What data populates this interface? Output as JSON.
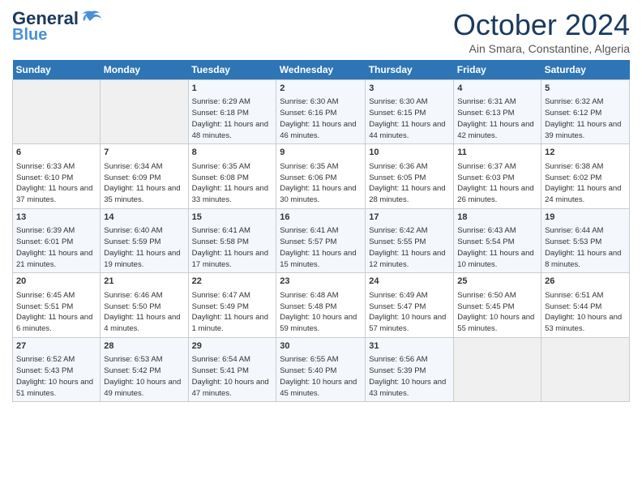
{
  "header": {
    "logo_line1": "General",
    "logo_line2": "Blue",
    "month": "October 2024",
    "location": "Ain Smara, Constantine, Algeria"
  },
  "days_of_week": [
    "Sunday",
    "Monday",
    "Tuesday",
    "Wednesday",
    "Thursday",
    "Friday",
    "Saturday"
  ],
  "weeks": [
    [
      {
        "day": "",
        "info": ""
      },
      {
        "day": "",
        "info": ""
      },
      {
        "day": "1",
        "info": "Sunrise: 6:29 AM\nSunset: 6:18 PM\nDaylight: 11 hours and 48 minutes."
      },
      {
        "day": "2",
        "info": "Sunrise: 6:30 AM\nSunset: 6:16 PM\nDaylight: 11 hours and 46 minutes."
      },
      {
        "day": "3",
        "info": "Sunrise: 6:30 AM\nSunset: 6:15 PM\nDaylight: 11 hours and 44 minutes."
      },
      {
        "day": "4",
        "info": "Sunrise: 6:31 AM\nSunset: 6:13 PM\nDaylight: 11 hours and 42 minutes."
      },
      {
        "day": "5",
        "info": "Sunrise: 6:32 AM\nSunset: 6:12 PM\nDaylight: 11 hours and 39 minutes."
      }
    ],
    [
      {
        "day": "6",
        "info": "Sunrise: 6:33 AM\nSunset: 6:10 PM\nDaylight: 11 hours and 37 minutes."
      },
      {
        "day": "7",
        "info": "Sunrise: 6:34 AM\nSunset: 6:09 PM\nDaylight: 11 hours and 35 minutes."
      },
      {
        "day": "8",
        "info": "Sunrise: 6:35 AM\nSunset: 6:08 PM\nDaylight: 11 hours and 33 minutes."
      },
      {
        "day": "9",
        "info": "Sunrise: 6:35 AM\nSunset: 6:06 PM\nDaylight: 11 hours and 30 minutes."
      },
      {
        "day": "10",
        "info": "Sunrise: 6:36 AM\nSunset: 6:05 PM\nDaylight: 11 hours and 28 minutes."
      },
      {
        "day": "11",
        "info": "Sunrise: 6:37 AM\nSunset: 6:03 PM\nDaylight: 11 hours and 26 minutes."
      },
      {
        "day": "12",
        "info": "Sunrise: 6:38 AM\nSunset: 6:02 PM\nDaylight: 11 hours and 24 minutes."
      }
    ],
    [
      {
        "day": "13",
        "info": "Sunrise: 6:39 AM\nSunset: 6:01 PM\nDaylight: 11 hours and 21 minutes."
      },
      {
        "day": "14",
        "info": "Sunrise: 6:40 AM\nSunset: 5:59 PM\nDaylight: 11 hours and 19 minutes."
      },
      {
        "day": "15",
        "info": "Sunrise: 6:41 AM\nSunset: 5:58 PM\nDaylight: 11 hours and 17 minutes."
      },
      {
        "day": "16",
        "info": "Sunrise: 6:41 AM\nSunset: 5:57 PM\nDaylight: 11 hours and 15 minutes."
      },
      {
        "day": "17",
        "info": "Sunrise: 6:42 AM\nSunset: 5:55 PM\nDaylight: 11 hours and 12 minutes."
      },
      {
        "day": "18",
        "info": "Sunrise: 6:43 AM\nSunset: 5:54 PM\nDaylight: 11 hours and 10 minutes."
      },
      {
        "day": "19",
        "info": "Sunrise: 6:44 AM\nSunset: 5:53 PM\nDaylight: 11 hours and 8 minutes."
      }
    ],
    [
      {
        "day": "20",
        "info": "Sunrise: 6:45 AM\nSunset: 5:51 PM\nDaylight: 11 hours and 6 minutes."
      },
      {
        "day": "21",
        "info": "Sunrise: 6:46 AM\nSunset: 5:50 PM\nDaylight: 11 hours and 4 minutes."
      },
      {
        "day": "22",
        "info": "Sunrise: 6:47 AM\nSunset: 5:49 PM\nDaylight: 11 hours and 1 minute."
      },
      {
        "day": "23",
        "info": "Sunrise: 6:48 AM\nSunset: 5:48 PM\nDaylight: 10 hours and 59 minutes."
      },
      {
        "day": "24",
        "info": "Sunrise: 6:49 AM\nSunset: 5:47 PM\nDaylight: 10 hours and 57 minutes."
      },
      {
        "day": "25",
        "info": "Sunrise: 6:50 AM\nSunset: 5:45 PM\nDaylight: 10 hours and 55 minutes."
      },
      {
        "day": "26",
        "info": "Sunrise: 6:51 AM\nSunset: 5:44 PM\nDaylight: 10 hours and 53 minutes."
      }
    ],
    [
      {
        "day": "27",
        "info": "Sunrise: 6:52 AM\nSunset: 5:43 PM\nDaylight: 10 hours and 51 minutes."
      },
      {
        "day": "28",
        "info": "Sunrise: 6:53 AM\nSunset: 5:42 PM\nDaylight: 10 hours and 49 minutes."
      },
      {
        "day": "29",
        "info": "Sunrise: 6:54 AM\nSunset: 5:41 PM\nDaylight: 10 hours and 47 minutes."
      },
      {
        "day": "30",
        "info": "Sunrise: 6:55 AM\nSunset: 5:40 PM\nDaylight: 10 hours and 45 minutes."
      },
      {
        "day": "31",
        "info": "Sunrise: 6:56 AM\nSunset: 5:39 PM\nDaylight: 10 hours and 43 minutes."
      },
      {
        "day": "",
        "info": ""
      },
      {
        "day": "",
        "info": ""
      }
    ]
  ]
}
